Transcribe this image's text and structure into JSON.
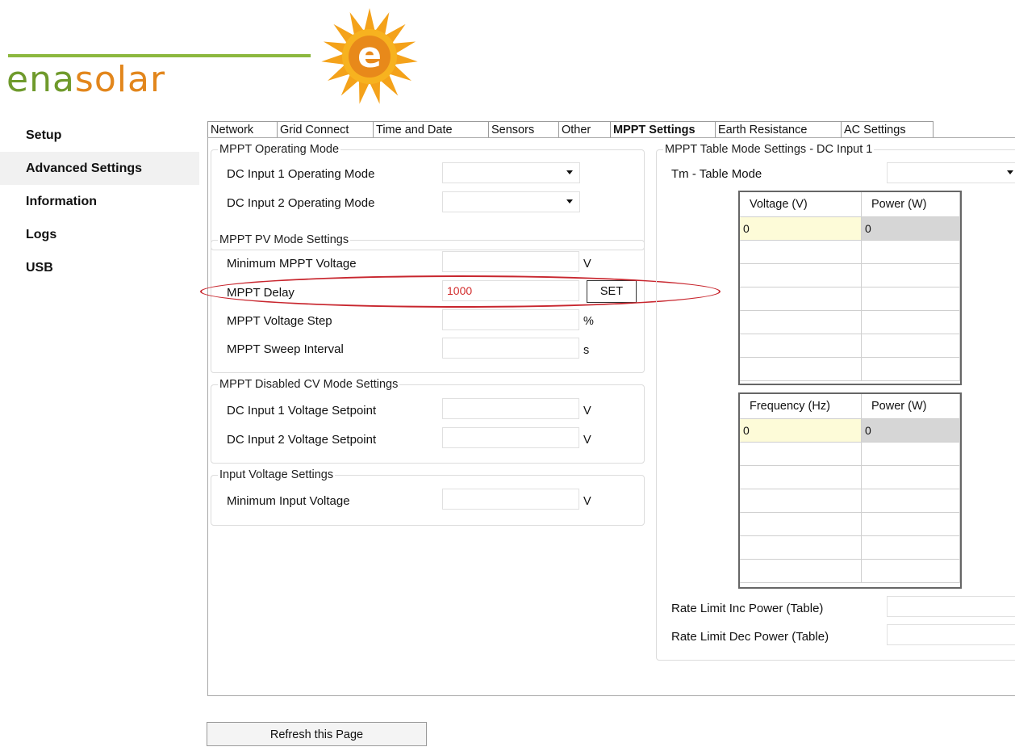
{
  "brand": {
    "logo_part1": "ena",
    "logo_part2": "solar",
    "sun_letter": "e"
  },
  "sidebar": {
    "items": [
      {
        "label": "Setup"
      },
      {
        "label": "Advanced Settings"
      },
      {
        "label": "Information"
      },
      {
        "label": "Logs"
      },
      {
        "label": "USB"
      }
    ]
  },
  "tabs": [
    {
      "label": "Network"
    },
    {
      "label": "Grid Connect"
    },
    {
      "label": "Time and Date"
    },
    {
      "label": "Sensors"
    },
    {
      "label": "Other"
    },
    {
      "label": "MPPT Settings"
    },
    {
      "label": "Earth Resistance"
    },
    {
      "label": "AC Settings"
    }
  ],
  "operating_mode": {
    "legend": "MPPT Operating Mode",
    "dc1_label": "DC Input 1 Operating Mode",
    "dc2_label": "DC Input 2 Operating Mode"
  },
  "pv_mode": {
    "legend": "MPPT PV Mode Settings",
    "min_voltage_label": "Minimum MPPT Voltage",
    "min_voltage_unit": "V",
    "delay_label": "MPPT Delay",
    "delay_value": "1000",
    "set_label": "SET",
    "step_label": "MPPT Voltage Step",
    "step_unit": "%",
    "sweep_label": "MPPT Sweep Interval",
    "sweep_unit": "s"
  },
  "cv_mode": {
    "legend": "MPPT Disabled CV Mode Settings",
    "dc1_label": "DC Input 1 Voltage Setpoint",
    "dc1_unit": "V",
    "dc2_label": "DC Input 2 Voltage Setpoint",
    "dc2_unit": "V"
  },
  "input_voltage": {
    "legend": "Input Voltage Settings",
    "min_label": "Minimum Input Voltage",
    "min_unit": "V"
  },
  "table_mode": {
    "legend": "MPPT Table Mode Settings - DC Input 1",
    "tm_label": "Tm - Table Mode",
    "voltage_table": {
      "col1": "Voltage (V)",
      "col2": "Power (W)",
      "rows": [
        [
          "0",
          "0"
        ],
        [
          "",
          ""
        ],
        [
          "",
          ""
        ],
        [
          "",
          ""
        ],
        [
          "",
          ""
        ],
        [
          "",
          ""
        ],
        [
          "",
          ""
        ]
      ]
    },
    "frequency_table": {
      "col1": "Frequency (Hz)",
      "col2": "Power (W)",
      "rows": [
        [
          "0",
          "0"
        ],
        [
          "",
          ""
        ],
        [
          "",
          ""
        ],
        [
          "",
          ""
        ],
        [
          "",
          ""
        ],
        [
          "",
          ""
        ],
        [
          "",
          ""
        ]
      ]
    },
    "rate_inc_label": "Rate Limit Inc Power (Table)",
    "rate_dec_label": "Rate Limit Dec Power (Table)"
  },
  "refresh_label": "Refresh this Page",
  "colors": {
    "annotation": "#c8262e",
    "logo_green": "#6f9a2c",
    "logo_orange": "#e2861c",
    "value_red": "#d22b2b"
  }
}
